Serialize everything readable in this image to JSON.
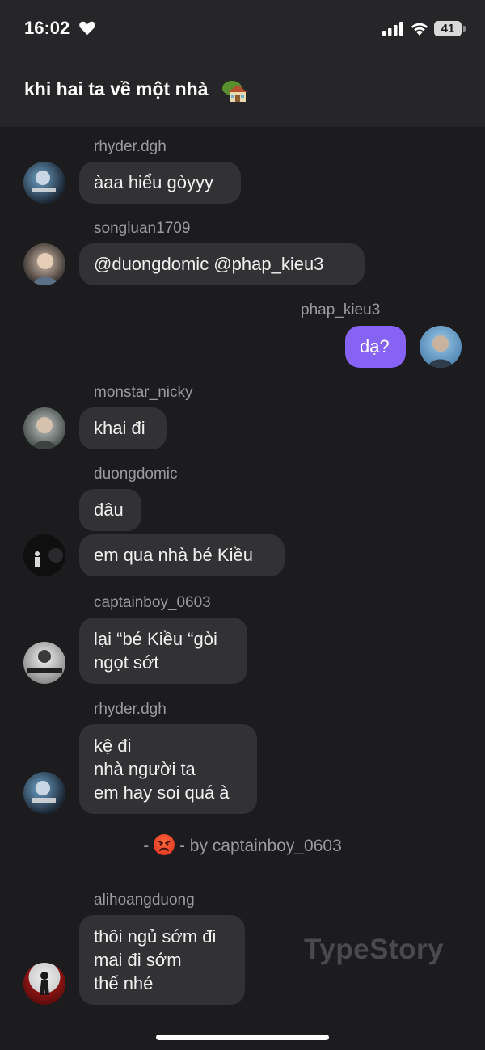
{
  "status": {
    "time": "16:02",
    "battery": "41"
  },
  "chat": {
    "title": "khi hai ta về một nhà"
  },
  "messages": [
    {
      "user": "rhyder.dgh",
      "lines": [
        "àaa hiểu gòyyy"
      ]
    },
    {
      "user": "songluan1709",
      "lines": [
        "@duongdomic @phap_kieu3"
      ]
    },
    {
      "user": "phap_kieu3",
      "lines": [
        "dạ?"
      ],
      "mine": true
    },
    {
      "user": "monstar_nicky",
      "lines": [
        "khai đi"
      ]
    },
    {
      "user": "duongdomic",
      "lines": [
        "đâu",
        "em qua nhà bé Kiều"
      ]
    },
    {
      "user": "captainboy_0603",
      "lines": [
        "lại “bé Kiều “gòi\nngọt sớt"
      ]
    },
    {
      "user": "rhyder.dgh",
      "lines": [
        "kệ đi\nnhà người ta\nem hay soi quá à"
      ]
    },
    {
      "user": "alihoangduong",
      "lines": [
        "thôi ngủ sớm đi\nmai đi sớm\nthế nhé"
      ]
    }
  ],
  "reaction": {
    "prefix": "-",
    "emoji_icon": "angry-face-icon",
    "text": "- by captainboy_0603"
  },
  "watermark": "TypeStory",
  "colors": {
    "background": "#1c1c1e",
    "header": "#262628",
    "bubble": "#323235",
    "my_bubble": "#8663f5",
    "username": "#9a9a9f"
  }
}
